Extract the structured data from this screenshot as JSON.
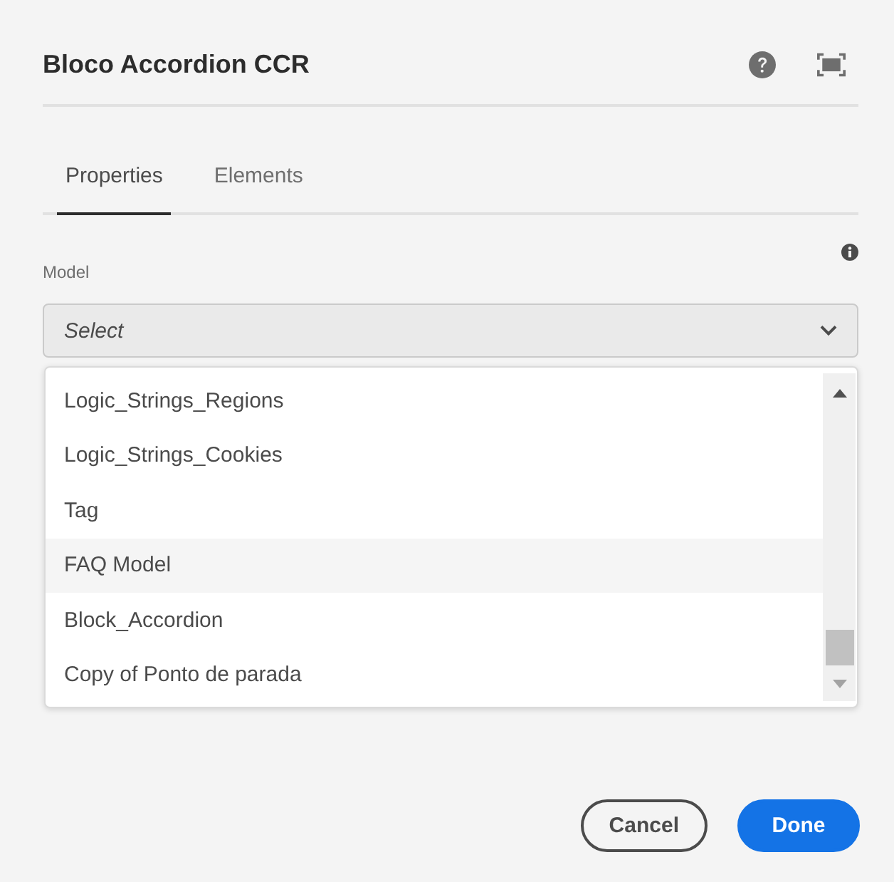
{
  "dialog": {
    "title": "Bloco Accordion CCR"
  },
  "tabs": [
    {
      "label": "Properties",
      "selected": true
    },
    {
      "label": "Elements",
      "selected": false
    }
  ],
  "model_field": {
    "label": "Model",
    "placeholder": "Select",
    "expanded": true
  },
  "options": [
    {
      "label": "Logic_Strings_Regions",
      "selected": false
    },
    {
      "label": "Logic_Strings_Cookies",
      "selected": false
    },
    {
      "label": "Tag",
      "selected": false
    },
    {
      "label": "FAQ Model",
      "selected": true
    },
    {
      "label": "Block_Accordion",
      "selected": false
    },
    {
      "label": "Copy of Ponto de parada",
      "selected": false
    }
  ],
  "buttons": [
    {
      "label": "Cancel",
      "kind": "secondary"
    },
    {
      "label": "Done",
      "kind": "primary"
    }
  ]
}
